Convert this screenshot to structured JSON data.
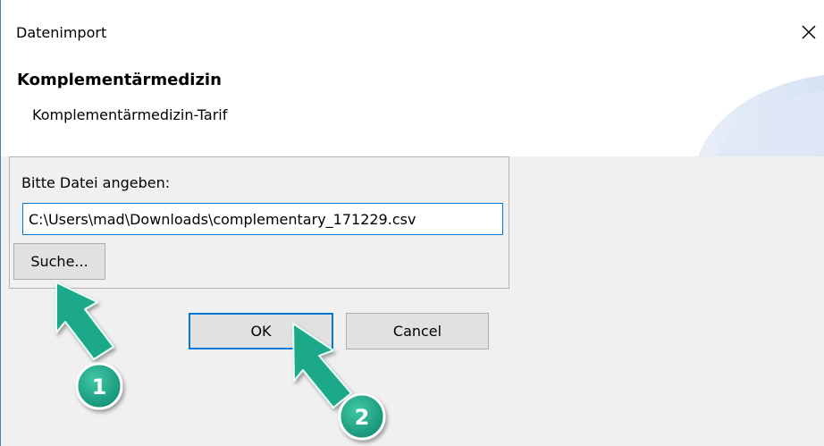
{
  "window": {
    "title": "Datenimport",
    "close_glyph": "✕"
  },
  "banner": {
    "heading": "Komplementärmedizin",
    "subheading": "Komplementärmedizin-Tarif"
  },
  "file_panel": {
    "label": "Bitte Datei angeben:",
    "path_value": "C:\\Users\\mad\\Downloads\\complementary_171229.csv",
    "browse_label": "Suche..."
  },
  "buttons": {
    "ok_label": "OK",
    "cancel_label": "Cancel"
  },
  "annotations": {
    "step1": "1",
    "step2": "2",
    "arrow_color": "#1aa98a"
  },
  "colors": {
    "focus_blue": "#0078d7",
    "dialog_bg": "#f0f0f0",
    "button_bg": "#e1e1e1"
  }
}
